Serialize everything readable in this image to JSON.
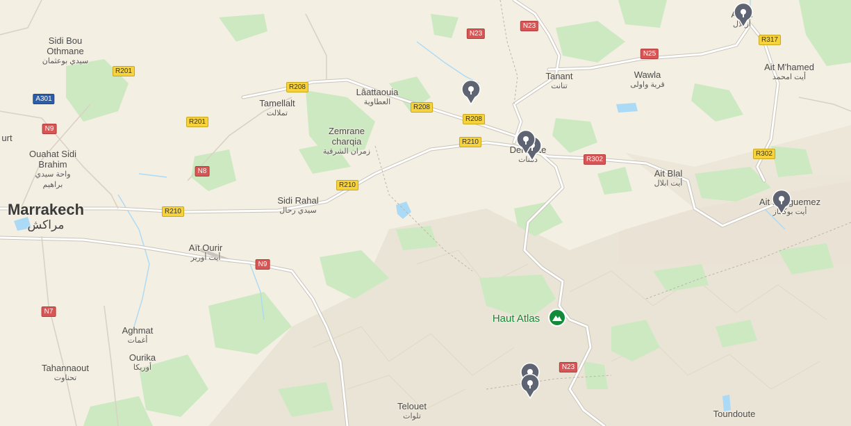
{
  "map": {
    "colors": {
      "land": "#f4efe3",
      "park": "#cde9c1",
      "water": "#aadaf6",
      "road": "#ffffff",
      "road_outline": "#c9c4bb",
      "pin": "#5f6472",
      "park_icon": "#138a3a"
    },
    "places": [
      {
        "name": "Sidi Bou Othmane",
        "line1": "Sidi Bou",
        "line2": "Othmane",
        "arabic": "سيدي بوعثمان"
      },
      {
        "name": "Tamellalt",
        "line1": "Tamellalt",
        "arabic": "تملالت"
      },
      {
        "name": "Lâattaouia",
        "line1": "Lâattaouia",
        "arabic": "العطاوية"
      },
      {
        "name": "Tanant",
        "line1": "Tanant",
        "arabic": "تنانت"
      },
      {
        "name": "Wawla",
        "line1": "Wawla",
        "arabic": "قرية واولى"
      },
      {
        "name": "Ait M'hamed",
        "line1": "Ait M'hamed",
        "arabic": "أيت امحمد"
      },
      {
        "name": "Zemrane charqia",
        "line1": "Zemrane",
        "line2": "charqia",
        "arabic": "زمران الشرقية"
      },
      {
        "name": "Ouahat Sidi Brahim",
        "line1": "Ouahat Sidi",
        "line2": "Brahim",
        "arabic": "واحة سيدي",
        "arabic2": "براهيم"
      },
      {
        "name": "Marrakech",
        "line1": "Marrakech",
        "arabic": "مراكش"
      },
      {
        "name": "Sidi Rahal",
        "line1": "Sidi Rahal",
        "arabic": "سيدي رحال"
      },
      {
        "name": "Aït Ourir",
        "line1": "Aït Ourir",
        "arabic": "أيت أورير"
      },
      {
        "name": "Ait Blal",
        "line1": "Ait Blal",
        "arabic": "أيت ابلال"
      },
      {
        "name": "Aghmat",
        "line1": "Aghmat",
        "arabic": "أغمات"
      },
      {
        "name": "Ourika",
        "line1": "Ourika",
        "arabic": "أوريكا"
      },
      {
        "name": "Tahannaout",
        "line1": "Tahannaout",
        "arabic": "تحناوت"
      },
      {
        "name": "Telouet",
        "line1": "Telouet",
        "arabic": "تلوات"
      },
      {
        "name": "Toundoute",
        "line1": "Toundoute"
      },
      {
        "name": "Ait Bouguemez",
        "line1": "Ait Bouguemez",
        "arabic": "أيت بوكماز"
      },
      {
        "name": "Demnate",
        "line1": "Demnate",
        "arabic": "دمنات"
      },
      {
        "name": "Azilal",
        "line1": "Azilal",
        "arabic": "أزيلال"
      },
      {
        "name": "urt",
        "line1": "urt"
      }
    ],
    "landmark": {
      "name": "Haut Atlas",
      "icon": "park-mountain-icon"
    },
    "road_shields": [
      {
        "label": "N23",
        "color": "red"
      },
      {
        "label": "N23",
        "color": "red"
      },
      {
        "label": "N25",
        "color": "red"
      },
      {
        "label": "R317",
        "color": "yellow"
      },
      {
        "label": "R201",
        "color": "yellow"
      },
      {
        "label": "A301",
        "color": "blue"
      },
      {
        "label": "R208",
        "color": "yellow"
      },
      {
        "label": "R208",
        "color": "yellow"
      },
      {
        "label": "R208",
        "color": "yellow"
      },
      {
        "label": "R201",
        "color": "yellow"
      },
      {
        "label": "N9",
        "color": "red"
      },
      {
        "label": "R210",
        "color": "yellow"
      },
      {
        "label": "R302",
        "color": "red"
      },
      {
        "label": "R302",
        "color": "yellow"
      },
      {
        "label": "N8",
        "color": "red"
      },
      {
        "label": "R210",
        "color": "yellow"
      },
      {
        "label": "R210",
        "color": "yellow"
      },
      {
        "label": "N9",
        "color": "red"
      },
      {
        "label": "N7",
        "color": "red"
      },
      {
        "label": "N23",
        "color": "red"
      }
    ],
    "markers": [
      {
        "icon": "map-pin-icon",
        "near": "Azilal"
      },
      {
        "icon": "map-pin-icon",
        "near": "Lâattaouia"
      },
      {
        "icon": "map-pin-icon",
        "near": "Demnate"
      },
      {
        "icon": "map-pin-icon",
        "near": "Demnate"
      },
      {
        "icon": "map-pin-icon",
        "near": "Ait Bouguemez"
      },
      {
        "icon": "map-pin-icon",
        "near": "Telouet"
      },
      {
        "icon": "map-pin-icon",
        "near": "Telouet"
      }
    ]
  }
}
